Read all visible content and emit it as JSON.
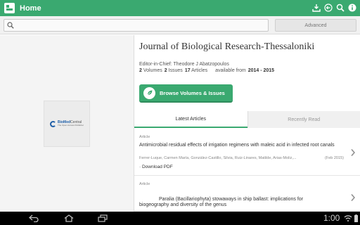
{
  "app": {
    "title": "Home"
  },
  "colors": {
    "brand_green": "#3aa970",
    "status_bar": "#000000"
  },
  "actionbar": {
    "icons": [
      "app-logo-icon",
      "download-icon",
      "back-arrow-icon",
      "search-icon",
      "info-icon"
    ]
  },
  "search": {
    "value": "",
    "placeholder": "",
    "advanced_label": "Advanced"
  },
  "journal": {
    "title": "Journal of Biological Research-Thessaloniki",
    "editor": "Editor-in-Chief: Theodore J Abatzopoulos",
    "volumes_count": "2",
    "volumes_label": "Volumes",
    "issues_count": "2",
    "issues_label": "Issues",
    "articles_count": "17",
    "articles_label": "Articles",
    "available_label": "available from",
    "available_range": "2014 - 2015",
    "cover": {
      "publisher": "BioMed",
      "publisher_suffix": "Central",
      "tagline": "The Open Access Publisher"
    }
  },
  "browse_button": {
    "label": "Browse Volumes & Issues",
    "icon": "leaf-icon"
  },
  "tabs": [
    {
      "label": "Latest Articles",
      "active": true
    },
    {
      "label": "Recently Read",
      "active": false
    }
  ],
  "articles": [
    {
      "type": "Article",
      "title": "Antimicrobial residual effects of irrigation regimens with maleic acid in infected root canals",
      "authors": "Ferrer-Luque, Carmen María, González-Castillo, Silvia, Ruiz-Linares, Matilde, Arias-Moliz,...",
      "date": "(Feb 2015)",
      "download_label": "· Download PDF"
    },
    {
      "type": "Article",
      "title_line1": "Paralia (Bacillariophyta) stowaways in ship ballast: implications for",
      "title_line2": "biogeography and diversity of the genus"
    }
  ],
  "statusbar": {
    "time": "1:00",
    "icons": [
      "nav-back-icon",
      "nav-home-icon",
      "nav-recents-icon",
      "wifi-icon",
      "battery-icon"
    ]
  }
}
